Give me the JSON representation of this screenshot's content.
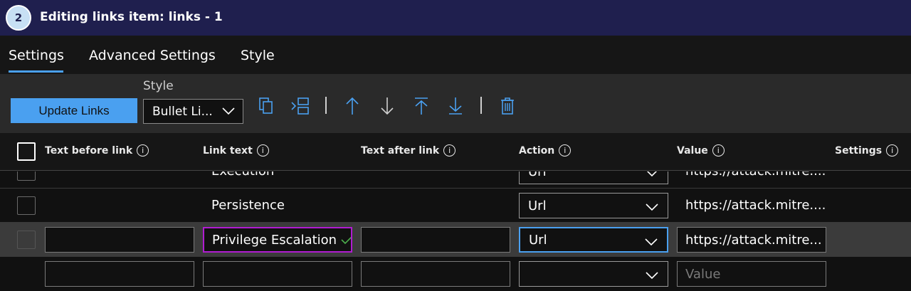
{
  "window": {
    "step": "2",
    "title": "Editing links item: links - 1"
  },
  "tabs": [
    "Settings",
    "Advanced Settings",
    "Style"
  ],
  "toolbar": {
    "update_label": "Update Links",
    "style_label": "Style",
    "style_value": "Bullet Li...",
    "icons": [
      "copy-icon",
      "insert-icon",
      "move-up-icon",
      "move-down-icon",
      "move-top-icon",
      "move-bottom-icon",
      "delete-icon"
    ]
  },
  "columns": [
    "Text before link",
    "Link text",
    "Text after link",
    "Action",
    "Value",
    "Settings"
  ],
  "rows": [
    {
      "link_text": "Execution",
      "action": "Url",
      "value": "https://attack.mitre...."
    },
    {
      "link_text": "Persistence",
      "action": "Url",
      "value": "https://attack.mitre...."
    },
    {
      "link_text": "Privilege Escalation",
      "action": "Url",
      "value": "https://attack.mitre..."
    },
    {
      "link_text": "",
      "action": "",
      "value": "",
      "value_placeholder": "Value"
    }
  ],
  "colors": {
    "accent": "#4aa0f0",
    "titlebar": "#1f1f4e",
    "selected_row": "#3b3b3b",
    "valid_check": "#4cae4c",
    "focus_border": "#b01cd1"
  }
}
